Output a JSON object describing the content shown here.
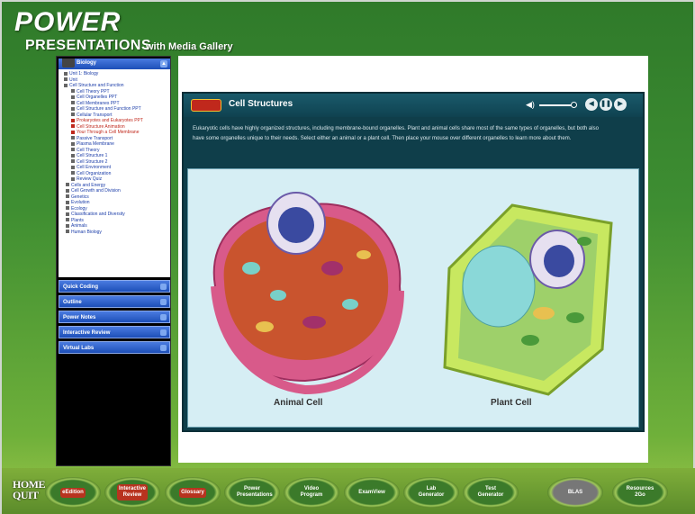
{
  "header": {
    "power": "POWER",
    "presentations": "PRESENTATIONS",
    "with": "with Media Gallery"
  },
  "sidebar": {
    "tree_title": "Biology",
    "tree_items": [
      {
        "label": "Unit 1: Biology",
        "red": false
      },
      {
        "label": "Unit",
        "red": false
      },
      {
        "label": "Cell Structure and Function",
        "red": false
      },
      {
        "label": "Cell Theory PPT",
        "red": false
      },
      {
        "label": "Cell Organelles PPT",
        "red": false
      },
      {
        "label": "Cell Membranes PPT",
        "red": false
      },
      {
        "label": "Cell Structure and Function PPT",
        "red": false
      },
      {
        "label": "Cellular Transport",
        "red": false
      },
      {
        "label": "Prokaryotes and Eukaryotes PPT",
        "red": true
      },
      {
        "label": "Cell Structure Animation",
        "red": true
      },
      {
        "label": "Your Through a Cell Membrane",
        "red": true
      },
      {
        "label": "Passive Transport",
        "red": false
      },
      {
        "label": "Plasma Membrane",
        "red": false
      },
      {
        "label": "Cell Theory",
        "red": false
      },
      {
        "label": "Cell Structure 1",
        "red": false
      },
      {
        "label": "Cell Structure 2",
        "red": false
      },
      {
        "label": "Cell Environment",
        "red": false
      },
      {
        "label": "Cell Organization",
        "red": false
      },
      {
        "label": "Review Quiz",
        "red": false
      },
      {
        "label": "Cells and Energy",
        "red": false
      },
      {
        "label": "Cell Growth and Division",
        "red": false
      },
      {
        "label": "Genetics",
        "red": false
      },
      {
        "label": "Evolution",
        "red": false
      },
      {
        "label": "Ecology",
        "red": false
      },
      {
        "label": "Classification and Diversity",
        "red": false
      },
      {
        "label": "Plants",
        "red": false
      },
      {
        "label": "Animals",
        "red": false
      },
      {
        "label": "Human Biology",
        "red": false
      }
    ],
    "accordions": [
      "Quick Coding",
      "Outline",
      "Power Notes",
      "Interactive Review",
      "Virtual Labs"
    ]
  },
  "viewer": {
    "title": "Cell Structures",
    "volume_icon": "speaker-icon",
    "description": "Eukaryotic cells have highly organized structures, including membrane-bound organelles. Plant and animal cells share most of the same types of organelles, but both also have some organelles unique to their needs. Select either an animal or a plant cell. Then place your mouse over different organelles to learn more about them.",
    "animal_caption": "Animal Cell",
    "plant_caption": "Plant Cell"
  },
  "bottom_nav": {
    "home": [
      "HOME",
      "QUIT"
    ],
    "buttons": [
      {
        "label": "eEdition",
        "style": "red"
      },
      {
        "label": "Interactive Review",
        "style": "red"
      },
      {
        "label": "Glossary",
        "style": "red"
      },
      {
        "label": "Power Presentations",
        "style": "green"
      },
      {
        "label": "Video Program",
        "style": "green"
      },
      {
        "label": "ExamView",
        "style": "green"
      },
      {
        "label": "Lab Generator",
        "style": "green"
      },
      {
        "label": "Test Generator",
        "style": "green"
      },
      {
        "label": "BLAS",
        "style": "grey"
      },
      {
        "label": "Resources 2Go",
        "style": "green"
      }
    ]
  },
  "colors": {
    "frame_green": "#3e8e32",
    "sidebar_blue": "#1d4fb8",
    "viewer_teal": "#0f3e4a",
    "accent_red": "#b8331f"
  }
}
